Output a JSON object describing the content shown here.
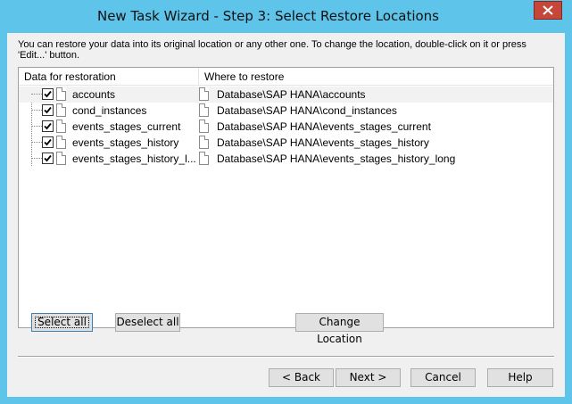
{
  "window": {
    "title": "New Task Wizard - Step 3: Select Restore Locations"
  },
  "instructions": "You can restore your data into its original location or any other one. To change the location, double-click on it or press 'Edit...' button.",
  "list": {
    "columns": [
      "Data for restoration",
      "Where to restore"
    ],
    "rows": [
      {
        "name": "accounts",
        "destination": "Database\\SAP HANA\\accounts",
        "checked": true
      },
      {
        "name": "cond_instances",
        "destination": "Database\\SAP HANA\\cond_instances",
        "checked": true
      },
      {
        "name": "events_stages_current",
        "destination": "Database\\SAP HANA\\events_stages_current",
        "checked": true
      },
      {
        "name": "events_stages_history",
        "destination": "Database\\SAP HANA\\events_stages_history",
        "checked": true
      },
      {
        "name": "events_stages_history_l...",
        "destination": "Database\\SAP HANA\\events_stages_history_long",
        "checked": true
      }
    ]
  },
  "buttons": {
    "select_all": "Select all",
    "deselect_all": "Deselect all",
    "change_location": "Change Location",
    "back": "< Back",
    "next": "Next >",
    "cancel": "Cancel",
    "help": "Help"
  },
  "colors": {
    "window_frame": "#5fc4ea",
    "close_button": "#c7463a",
    "dialog_background": "#f0f0f0"
  }
}
